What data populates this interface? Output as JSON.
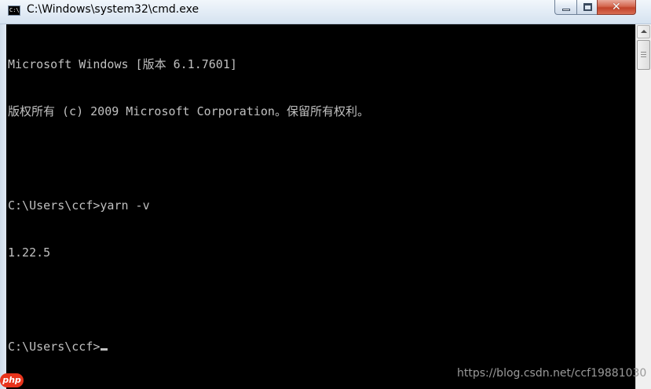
{
  "window": {
    "title": "C:\\Windows\\system32\\cmd.exe",
    "icon": "cmd-icon",
    "icon_text": "C:\\"
  },
  "controls": {
    "minimize": "minimize-icon",
    "maximize": "maximize-icon",
    "close": "close-icon",
    "close_glyph": "✕"
  },
  "console": {
    "lines": [
      "Microsoft Windows [版本 6.1.7601]",
      "版权所有 (c) 2009 Microsoft Corporation。保留所有权利。",
      "",
      "C:\\Users\\ccf>yarn -v",
      "1.22.5",
      "",
      "C:\\Users\\ccf>"
    ],
    "text_color": "#c0c0c0",
    "background_color": "#000000"
  },
  "watermark": {
    "text": "https://blog.csdn.net/ccf19881030"
  },
  "badge": {
    "text": "php",
    "color": "#e8341c"
  }
}
